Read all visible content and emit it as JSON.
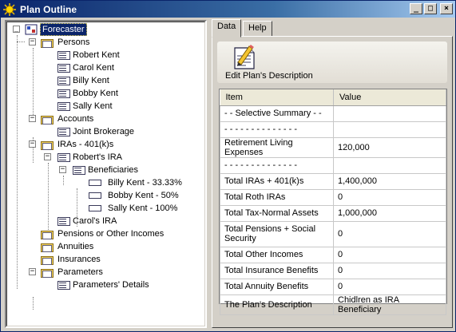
{
  "window": {
    "title": "Plan Outline",
    "minimize": "_",
    "maximize": "□",
    "close": "×"
  },
  "tree": {
    "root": "Forecaster",
    "persons": "Persons",
    "person_items": [
      "Robert Kent",
      "Carol Kent",
      "Billy Kent",
      "Bobby Kent",
      "Sally Kent"
    ],
    "accounts": "Accounts",
    "joint_brokerage": "Joint Brokerage",
    "iras": "IRAs - 401(k)s",
    "roberts_ira": "Robert's IRA",
    "beneficiaries": "Beneficiaries",
    "beneficiary_items": [
      "Billy Kent - 33.33%",
      "Bobby Kent - 50%",
      "Sally Kent - 100%"
    ],
    "carols_ira": "Carol's IRA",
    "pensions": "Pensions or Other Incomes",
    "annuities": "Annuities",
    "insurances": "Insurances",
    "parameters": "Parameters",
    "parameters_details": "Parameters' Details"
  },
  "tabs": [
    "Data",
    "Help"
  ],
  "toolbar": {
    "edit_label": "Edit Plan's Description"
  },
  "grid": {
    "headers": [
      "Item",
      "Value"
    ],
    "rows": [
      {
        "item": "- - Selective Summary - -",
        "value": ""
      },
      {
        "item": "- - - - - - - - - - - - - -",
        "value": ""
      },
      {
        "item": "Retirement Living Expenses",
        "value": "120,000"
      },
      {
        "item": "- - - - - - - - - - - - - -",
        "value": ""
      },
      {
        "item": "Total IRAs + 401(k)s",
        "value": "1,400,000"
      },
      {
        "item": "Total Roth IRAs",
        "value": "0"
      },
      {
        "item": "Total Tax-Normal Assets",
        "value": "1,000,000"
      },
      {
        "item": "Total Pensions + Social Security",
        "value": "0"
      },
      {
        "item": "Total Other Incomes",
        "value": "0"
      },
      {
        "item": "Total Insurance Benefits",
        "value": "0"
      },
      {
        "item": "Total Annuity Benefits",
        "value": "0"
      },
      {
        "item": "The Plan's Description",
        "value": "Chidlren as IRA Beneficiary"
      }
    ]
  }
}
